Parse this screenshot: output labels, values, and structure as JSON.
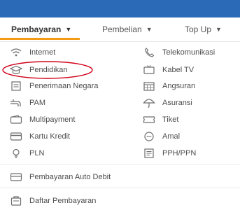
{
  "tabs": [
    {
      "label": "Pembayaran",
      "active": true
    },
    {
      "label": "Pembelian",
      "active": false
    },
    {
      "label": "Top Up",
      "active": false
    }
  ],
  "left_items": [
    {
      "label": "Internet",
      "icon": "wifi-icon"
    },
    {
      "label": "Pendidikan",
      "icon": "graduation-cap-icon"
    },
    {
      "label": "Penerimaan Negara",
      "icon": "document-icon"
    },
    {
      "label": "PAM",
      "icon": "water-tap-icon"
    },
    {
      "label": "Multipayment",
      "icon": "wallet-icon"
    },
    {
      "label": "Kartu Kredit",
      "icon": "credit-card-icon"
    },
    {
      "label": "PLN",
      "icon": "lightbulb-icon"
    }
  ],
  "right_items": [
    {
      "label": "Telekomunikasi",
      "icon": "phone-icon"
    },
    {
      "label": "Kabel TV",
      "icon": "tv-icon"
    },
    {
      "label": "Angsuran",
      "icon": "calendar-icon"
    },
    {
      "label": "Asuransi",
      "icon": "umbrella-icon"
    },
    {
      "label": "Tiket",
      "icon": "ticket-icon"
    },
    {
      "label": "Amal",
      "icon": "donation-icon"
    },
    {
      "label": "PPH/PPN",
      "icon": "tax-document-icon"
    }
  ],
  "bottom_items": [
    {
      "label": "Pembayaran Auto Debit",
      "icon": "auto-debit-icon"
    },
    {
      "label": "Daftar Pembayaran",
      "icon": "payment-list-icon"
    }
  ],
  "colors": {
    "topbar": "#2a6ab6",
    "active_underline": "#f39a16",
    "annotation": "#d0021b"
  }
}
